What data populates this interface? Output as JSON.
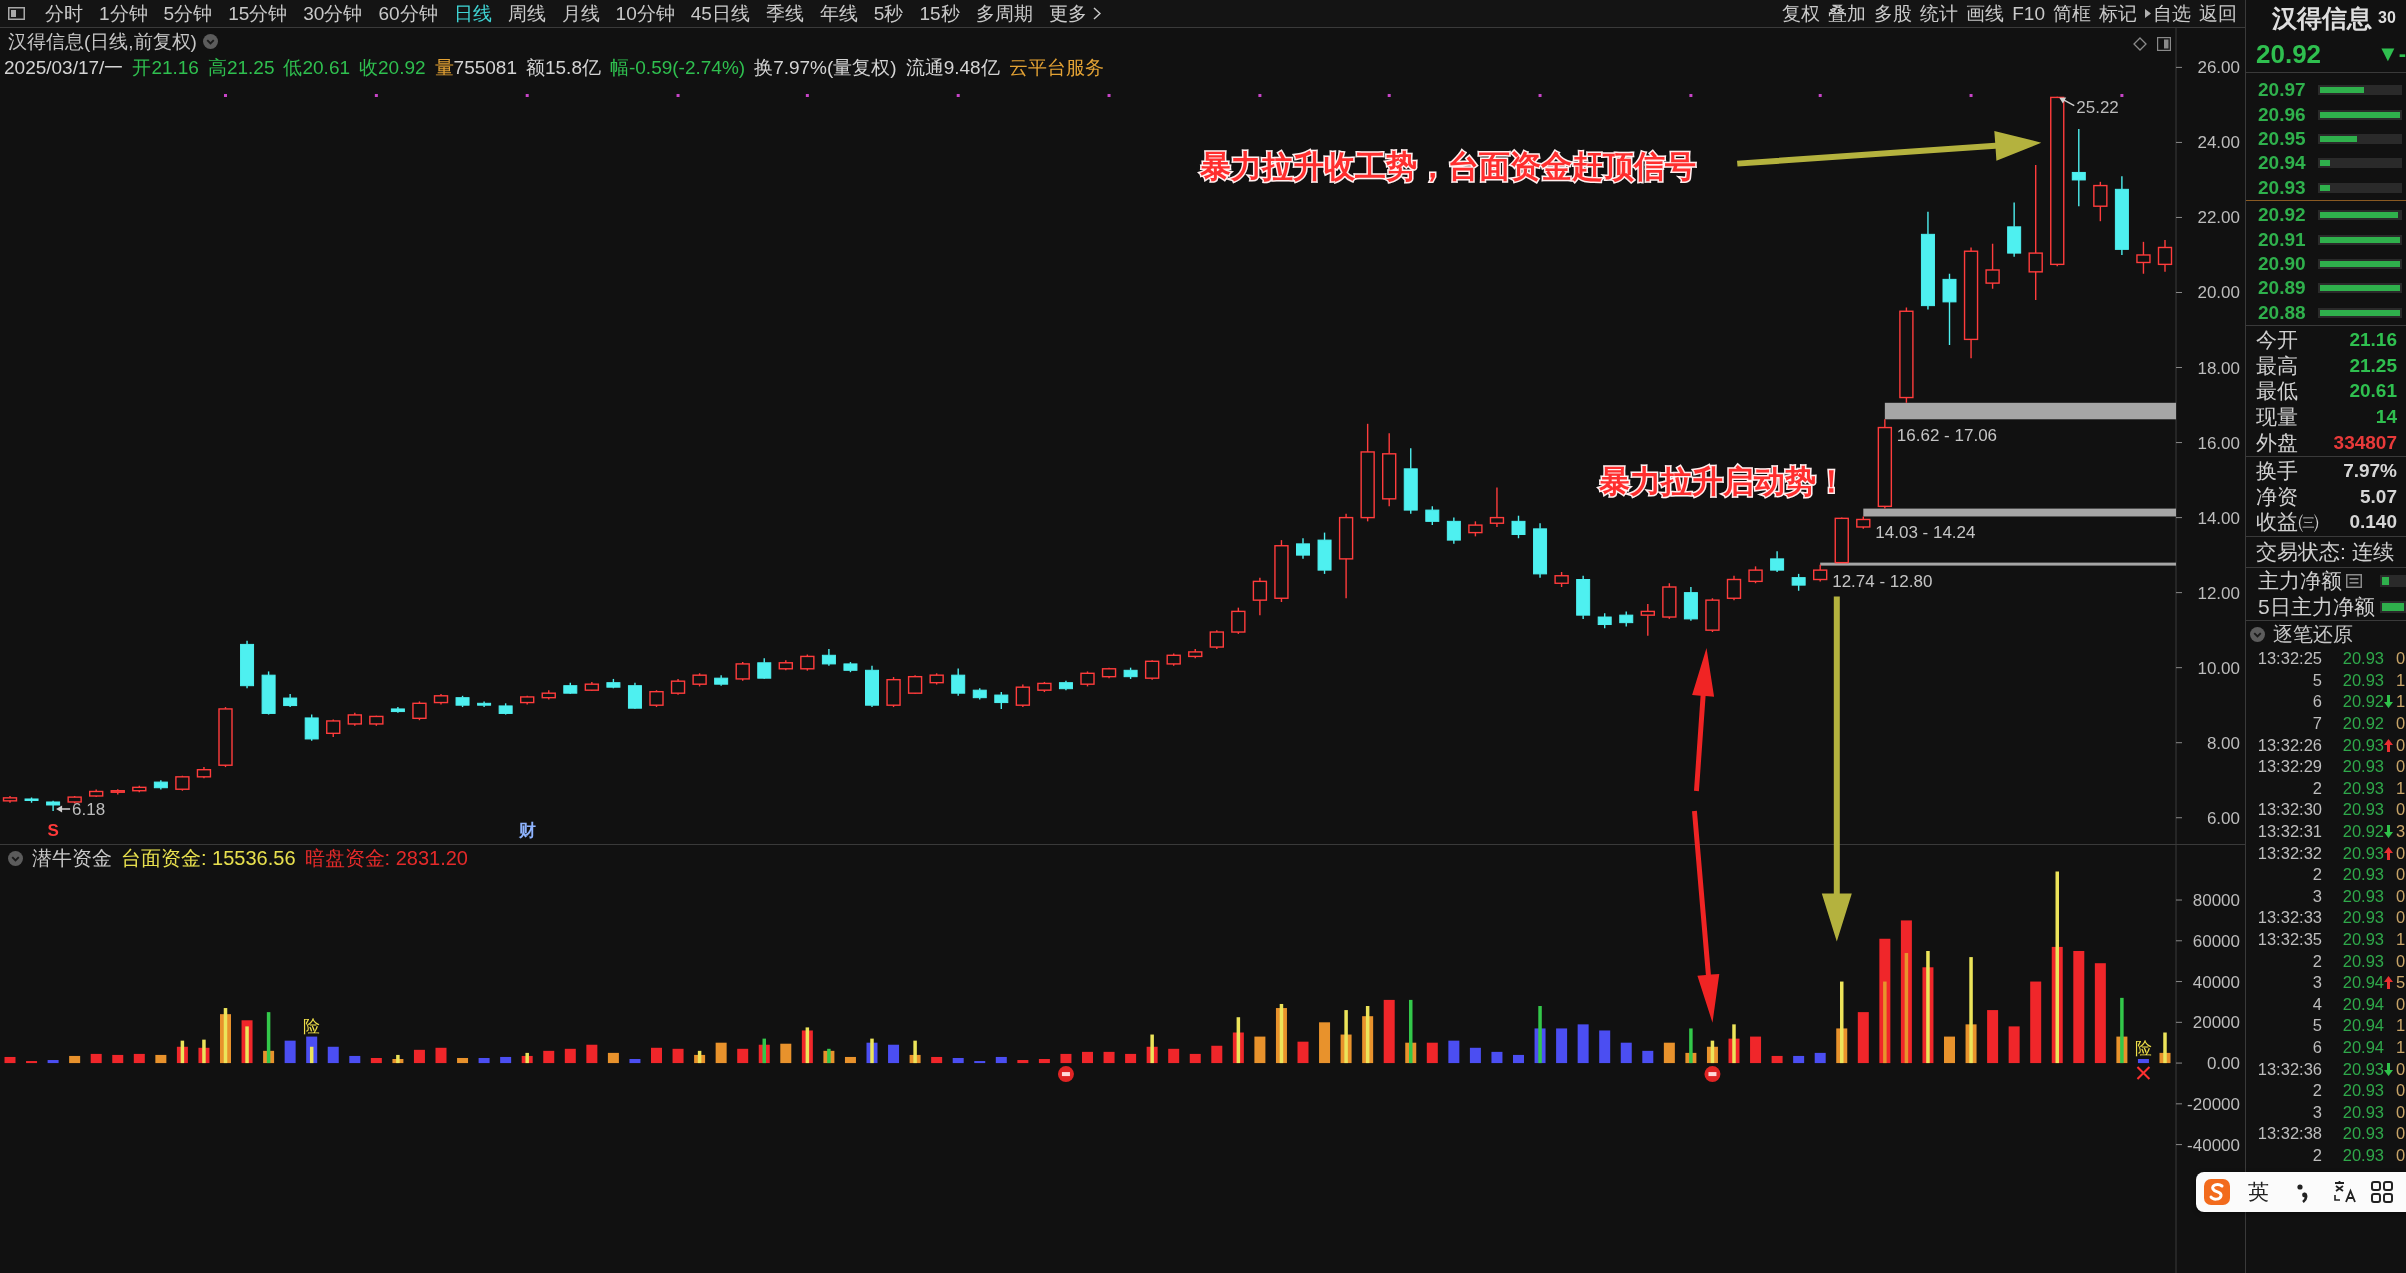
{
  "toolbar": {
    "tabs": [
      {
        "label": "分时",
        "kind": "period",
        "selected": false
      },
      {
        "label": "1分钟",
        "kind": "period",
        "selected": false
      },
      {
        "label": "5分钟",
        "kind": "period",
        "selected": false
      },
      {
        "label": "15分钟",
        "kind": "period",
        "selected": false
      },
      {
        "label": "30分钟",
        "kind": "period",
        "selected": false
      },
      {
        "label": "60分钟",
        "kind": "period",
        "selected": false
      },
      {
        "label": "日线",
        "kind": "period",
        "selected": true
      },
      {
        "label": "周线",
        "kind": "period",
        "selected": false
      },
      {
        "label": "月线",
        "kind": "period",
        "selected": false
      },
      {
        "label": "10分钟",
        "kind": "period",
        "selected": false
      },
      {
        "label": "45日线",
        "kind": "period",
        "selected": false
      },
      {
        "label": "季线",
        "kind": "period",
        "selected": false
      },
      {
        "label": "年线",
        "kind": "period",
        "selected": false
      },
      {
        "label": "5秒",
        "kind": "period",
        "selected": false
      },
      {
        "label": "15秒",
        "kind": "period",
        "selected": false
      },
      {
        "label": "多周期",
        "kind": "period",
        "selected": false
      },
      {
        "label": "更多",
        "kind": "menu",
        "selected": false
      }
    ],
    "tools": [
      {
        "label": "复权",
        "submenu": false
      },
      {
        "label": "叠加",
        "submenu": false
      },
      {
        "label": "多股",
        "submenu": false
      },
      {
        "label": "统计",
        "submenu": false
      },
      {
        "label": "画线",
        "submenu": false
      },
      {
        "label": "F10",
        "submenu": false
      },
      {
        "label": "简框",
        "submenu": false
      },
      {
        "label": "标记",
        "submenu": false
      },
      {
        "label": "自选",
        "submenu": true
      },
      {
        "label": "返回",
        "submenu": false
      }
    ]
  },
  "chart": {
    "title": "汉得信息(日线,前复权)",
    "quote_line": [
      {
        "parts": [
          {
            "text": "2025/03/17/一",
            "color": "#d4d4d4"
          }
        ]
      },
      {
        "parts": [
          {
            "text": "开21.16",
            "color": "#2fbf4f"
          }
        ]
      },
      {
        "parts": [
          {
            "text": "高21.25",
            "color": "#2fbf4f"
          }
        ]
      },
      {
        "parts": [
          {
            "text": "低20.61",
            "color": "#2fbf4f"
          }
        ]
      },
      {
        "parts": [
          {
            "text": "收20.92",
            "color": "#2fbf4f"
          }
        ]
      },
      {
        "parts": [
          {
            "text": "量",
            "color": "#e3a234"
          },
          {
            "text": "755081",
            "color": "#d4d4d4"
          }
        ]
      },
      {
        "parts": [
          {
            "text": "额15.8亿",
            "color": "#d4d4d4"
          }
        ]
      },
      {
        "parts": [
          {
            "text": "幅-0.59(-2.74%)",
            "color": "#2fbf4f"
          }
        ]
      },
      {
        "parts": [
          {
            "text": "换7.97%(量复权)",
            "color": "#d4d4d4"
          }
        ]
      },
      {
        "parts": [
          {
            "text": "流通9.48亿",
            "color": "#d4d4d4"
          }
        ]
      },
      {
        "parts": [
          {
            "text": "云平台服务",
            "color": "#e3a234"
          }
        ]
      }
    ],
    "indicator": {
      "name": "潜牛资金",
      "legend": [
        {
          "text": "台面资金: 15536.56",
          "color": "#e8e04e"
        },
        {
          "text": "暗盘资金: 2831.20",
          "color": "#e42a2a"
        }
      ]
    },
    "chart_data": [
      {
        "type": "candlestick",
        "ylim": [
          5.3,
          27.05
        ],
        "yticks": [
          {
            "value": 6,
            "label": "6.00"
          },
          {
            "value": 8,
            "label": "8.00"
          },
          {
            "value": 10,
            "label": "10.00"
          },
          {
            "value": 12,
            "label": "12.00"
          },
          {
            "value": 14,
            "label": "14.00"
          },
          {
            "value": 16,
            "label": "16.00"
          },
          {
            "value": 18,
            "label": "18.00"
          },
          {
            "value": 20,
            "label": "20.00"
          },
          {
            "value": 22,
            "label": "22.00"
          },
          {
            "value": 24,
            "label": "24.00"
          },
          {
            "value": 26,
            "label": "26.00"
          }
        ],
        "ohlc": [
          [
            6.45,
            6.58,
            6.4,
            6.53
          ],
          [
            6.5,
            6.54,
            6.4,
            6.46
          ],
          [
            6.42,
            6.45,
            6.18,
            6.34
          ],
          [
            6.42,
            6.58,
            6.38,
            6.55
          ],
          [
            6.58,
            6.75,
            6.55,
            6.7
          ],
          [
            6.7,
            6.76,
            6.62,
            6.72
          ],
          [
            6.72,
            6.85,
            6.68,
            6.81
          ],
          [
            6.95,
            7.0,
            6.75,
            6.8
          ],
          [
            6.76,
            7.12,
            6.72,
            7.09
          ],
          [
            7.09,
            7.35,
            7.05,
            7.28
          ],
          [
            7.4,
            8.95,
            7.35,
            8.9
          ],
          [
            10.62,
            10.72,
            9.45,
            9.52
          ],
          [
            9.8,
            9.9,
            8.75,
            8.78
          ],
          [
            9.19,
            9.3,
            8.95,
            8.99
          ],
          [
            8.66,
            8.75,
            8.05,
            8.1
          ],
          [
            8.25,
            8.62,
            8.15,
            8.58
          ],
          [
            8.5,
            8.8,
            8.45,
            8.74
          ],
          [
            8.5,
            8.72,
            8.45,
            8.7
          ],
          [
            8.9,
            8.95,
            8.8,
            8.83
          ],
          [
            8.65,
            9.1,
            8.6,
            9.05
          ],
          [
            9.07,
            9.3,
            9.02,
            9.25
          ],
          [
            9.2,
            9.25,
            8.95,
            9.0
          ],
          [
            9.05,
            9.1,
            8.95,
            9.0
          ],
          [
            8.98,
            9.05,
            8.75,
            8.78
          ],
          [
            9.07,
            9.25,
            9.02,
            9.22
          ],
          [
            9.2,
            9.4,
            9.15,
            9.32
          ],
          [
            9.52,
            9.6,
            9.3,
            9.32
          ],
          [
            9.4,
            9.62,
            9.38,
            9.56
          ],
          [
            9.6,
            9.7,
            9.45,
            9.48
          ],
          [
            9.52,
            9.6,
            8.9,
            8.92
          ],
          [
            9.0,
            9.4,
            8.95,
            9.36
          ],
          [
            9.32,
            9.7,
            9.28,
            9.64
          ],
          [
            9.56,
            9.85,
            9.5,
            9.8
          ],
          [
            9.72,
            9.8,
            9.52,
            9.56
          ],
          [
            9.7,
            10.15,
            9.65,
            10.1
          ],
          [
            10.13,
            10.25,
            9.7,
            9.72
          ],
          [
            9.97,
            10.2,
            9.93,
            10.13
          ],
          [
            9.97,
            10.35,
            9.92,
            10.3
          ],
          [
            10.33,
            10.5,
            10.05,
            10.1
          ],
          [
            10.1,
            10.15,
            9.88,
            9.93
          ],
          [
            9.93,
            10.05,
            8.95,
            9.0
          ],
          [
            9.0,
            9.75,
            8.95,
            9.68
          ],
          [
            9.32,
            9.8,
            9.3,
            9.76
          ],
          [
            9.6,
            9.85,
            9.55,
            9.8
          ],
          [
            9.8,
            9.98,
            9.25,
            9.32
          ],
          [
            9.4,
            9.45,
            9.15,
            9.2
          ],
          [
            9.27,
            9.35,
            8.9,
            9.07
          ],
          [
            9.0,
            9.55,
            8.95,
            9.48
          ],
          [
            9.4,
            9.62,
            9.35,
            9.58
          ],
          [
            9.6,
            9.65,
            9.4,
            9.44
          ],
          [
            9.56,
            9.9,
            9.5,
            9.85
          ],
          [
            9.76,
            10.0,
            9.72,
            9.97
          ],
          [
            9.93,
            10.0,
            9.7,
            9.76
          ],
          [
            9.72,
            10.2,
            9.68,
            10.17
          ],
          [
            10.1,
            10.38,
            10.05,
            10.33
          ],
          [
            10.3,
            10.5,
            10.25,
            10.42
          ],
          [
            10.55,
            11.0,
            10.5,
            10.95
          ],
          [
            10.95,
            11.6,
            10.9,
            11.5
          ],
          [
            11.8,
            12.4,
            11.4,
            12.3
          ],
          [
            11.85,
            13.4,
            11.75,
            13.25
          ],
          [
            13.3,
            13.45,
            12.9,
            13.0
          ],
          [
            13.4,
            13.6,
            12.5,
            12.6
          ],
          [
            12.9,
            14.1,
            11.85,
            14.0
          ],
          [
            14.0,
            16.5,
            13.9,
            15.75
          ],
          [
            14.5,
            16.25,
            14.3,
            15.7
          ],
          [
            15.3,
            15.85,
            14.1,
            14.2
          ],
          [
            14.2,
            14.3,
            13.8,
            13.9
          ],
          [
            13.9,
            14.0,
            13.3,
            13.4
          ],
          [
            13.6,
            13.9,
            13.5,
            13.8
          ],
          [
            13.85,
            14.8,
            13.75,
            14.0
          ],
          [
            13.9,
            14.05,
            13.45,
            13.55
          ],
          [
            13.7,
            13.85,
            12.4,
            12.5
          ],
          [
            12.25,
            12.55,
            12.15,
            12.45
          ],
          [
            12.35,
            12.45,
            11.3,
            11.4
          ],
          [
            11.35,
            11.45,
            11.05,
            11.15
          ],
          [
            11.4,
            11.5,
            11.1,
            11.2
          ],
          [
            11.4,
            11.7,
            10.85,
            11.5
          ],
          [
            11.35,
            12.25,
            11.3,
            12.15
          ],
          [
            12.0,
            12.15,
            11.25,
            11.3
          ],
          [
            11.0,
            11.85,
            10.95,
            11.8
          ],
          [
            11.85,
            12.45,
            11.8,
            12.35
          ],
          [
            12.3,
            12.7,
            12.25,
            12.6
          ],
          [
            12.9,
            13.1,
            12.55,
            12.6
          ],
          [
            12.4,
            12.5,
            12.05,
            12.2
          ],
          [
            12.35,
            12.74,
            12.3,
            12.6
          ],
          [
            12.8,
            14.0,
            12.8,
            13.98
          ],
          [
            13.75,
            14.03,
            13.7,
            13.95
          ],
          [
            14.3,
            16.62,
            14.24,
            16.4
          ],
          [
            17.2,
            19.6,
            17.06,
            19.5
          ],
          [
            21.55,
            22.15,
            19.55,
            19.65
          ],
          [
            20.35,
            20.5,
            18.6,
            19.75
          ],
          [
            18.75,
            21.2,
            18.25,
            21.1
          ],
          [
            20.25,
            21.3,
            20.1,
            20.6
          ],
          [
            21.75,
            22.4,
            20.95,
            21.05
          ],
          [
            20.55,
            23.4,
            19.8,
            21.05
          ],
          [
            20.75,
            25.22,
            20.7,
            25.2
          ],
          [
            23.2,
            24.36,
            22.3,
            23.0
          ],
          [
            22.3,
            22.95,
            21.9,
            22.85
          ],
          [
            22.75,
            23.1,
            21.0,
            21.15
          ],
          [
            20.8,
            21.35,
            20.5,
            21.0
          ],
          [
            20.75,
            21.4,
            20.55,
            21.2
          ]
        ],
        "bands": [
          {
            "axis": "y",
            "from": 16.62,
            "to": 17.06,
            "label": "16.62 - 17.06",
            "color": "#a6a6a6"
          },
          {
            "axis": "y",
            "from": 14.03,
            "to": 14.24,
            "label": "14.03 - 14.24",
            "color": "#a6a6a6"
          },
          {
            "axis": "y",
            "from": 12.74,
            "to": 12.8,
            "label": "12.74 - 12.80",
            "color": "#a6a6a6"
          }
        ],
        "annotations": [
          "25.22",
          "6.18",
          "S",
          "财",
          "暴力拉升收工势，台面资金赶顶信号",
          "暴力拉升启动势！"
        ]
      },
      {
        "type": "bar",
        "ylim": [
          -103000,
          107000
        ],
        "yticks": [
          {
            "value": 80000,
            "label": "80000"
          },
          {
            "value": 60000,
            "label": "60000"
          },
          {
            "value": 40000,
            "label": "40000"
          },
          {
            "value": 20000,
            "label": "20000"
          },
          {
            "value": 0,
            "label": "0.00"
          },
          {
            "value": -20000,
            "label": "-20000"
          },
          {
            "value": -40000,
            "label": "-40000"
          }
        ],
        "series": [
          {
            "values": [
              3000,
              1000,
              1500,
              3500,
              4500,
              4000,
              4500,
              4000,
              8000,
              7500,
              24000,
              21000,
              6000,
              11000,
              13000,
              8000,
              3500,
              2500,
              2000,
              6500,
              7500,
              2500,
              2500,
              3000,
              3500,
              6000,
              7000,
              9000,
              5000,
              2000,
              7500,
              7000,
              4000,
              10000,
              7000,
              9000,
              9500,
              16000,
              6000,
              3000,
              10000,
              9000,
              4000,
              3000,
              2500,
              1000,
              3000,
              1500,
              2000,
              4500,
              5500,
              5500,
              4500,
              8000,
              7000,
              4500,
              8500,
              15000,
              13000,
              27000,
              10500,
              20000,
              14000,
              23000,
              31000,
              10000,
              10000,
              11000,
              7500,
              5500,
              4000,
              17000,
              17000,
              19000,
              16000,
              10000,
              6000,
              10000,
              5000,
              8000,
              12000,
              13000,
              3500,
              3500,
              5000,
              17000,
              25000,
              61000,
              70000,
              47000,
              13000,
              19000,
              26000,
              18000,
              40000,
              57000,
              55000,
              49000,
              13000,
              2000,
              5000
            ],
            "colors": [
              "#f0262a",
              "#f0262a",
              "#4b4ef2",
              "#e8922c",
              "#f0262a",
              "#f0262a",
              "#f0262a",
              "#e8922c",
              "#f0262a",
              "#f0262a",
              "#e8922c",
              "#f0262a",
              "#e8922c",
              "#4b4ef2",
              "#4b4ef2",
              "#4b4ef2",
              "#4b4ef2",
              "#f0262a",
              "#e8922c",
              "#f0262a",
              "#f0262a",
              "#e8922c",
              "#4b4ef2",
              "#4b4ef2",
              "#f0262a",
              "#f0262a",
              "#f0262a",
              "#f0262a",
              "#e8922c",
              "#4b4ef2",
              "#f0262a",
              "#f0262a",
              "#e8922c",
              "#e8922c",
              "#f0262a",
              "#f0262a",
              "#e8922c",
              "#f0262a",
              "#e8922c",
              "#e8922c",
              "#4b4ef2",
              "#4b4ef2",
              "#e8922c",
              "#f0262a",
              "#4b4ef2",
              "#4b4ef2",
              "#4b4ef2",
              "#f0262a",
              "#f0262a",
              "#f0262a",
              "#f0262a",
              "#f0262a",
              "#f0262a",
              "#f0262a",
              "#f0262a",
              "#f0262a",
              "#f0262a",
              "#f0262a",
              "#e8922c",
              "#e8922c",
              "#f0262a",
              "#e8922c",
              "#e8922c",
              "#e8922c",
              "#f0262a",
              "#e8922c",
              "#f0262a",
              "#4b4ef2",
              "#4b4ef2",
              "#4b4ef2",
              "#4b4ef2",
              "#4b4ef2",
              "#4b4ef2",
              "#4b4ef2",
              "#4b4ef2",
              "#4b4ef2",
              "#4b4ef2",
              "#e8922c",
              "#e8922c",
              "#e8922c",
              "#f0262a",
              "#f0262a",
              "#f0262a",
              "#4b4ef2",
              "#4b4ef2",
              "#e8922c",
              "#f0262a",
              "#f0262a",
              "#f0262a",
              "#f0262a",
              "#e8922c",
              "#e8922c",
              "#f0262a",
              "#f0262a",
              "#f0262a",
              "#f0262a",
              "#f0262a",
              "#f0262a",
              "#e8922c",
              "#4b4ef2",
              "#e8922c"
            ]
          },
          {
            "values": [
              null,
              null,
              null,
              null,
              null,
              null,
              null,
              null,
              11000,
              11500,
              27000,
              18000,
              25000,
              null,
              8000,
              null,
              null,
              null,
              4000,
              null,
              null,
              null,
              null,
              null,
              5000,
              null,
              null,
              null,
              null,
              null,
              null,
              null,
              6000,
              null,
              null,
              12000,
              null,
              17500,
              7000,
              null,
              12000,
              null,
              11000,
              null,
              null,
              null,
              null,
              null,
              null,
              null,
              null,
              null,
              null,
              14000,
              null,
              null,
              null,
              22500,
              null,
              29000,
              null,
              null,
              26000,
              28000,
              null,
              31000,
              null,
              null,
              null,
              null,
              null,
              28000,
              null,
              null,
              null,
              null,
              null,
              null,
              17000,
              11000,
              19000,
              null,
              null,
              null,
              null,
              40000,
              null,
              40000,
              54000,
              55000,
              null,
              52000,
              null,
              null,
              null,
              94000,
              null,
              null,
              32000,
              null,
              15000
            ],
            "colors": [
              null,
              null,
              null,
              null,
              null,
              null,
              null,
              null,
              "#ece45a",
              "#ece45a",
              "#ece45a",
              "#ece45a",
              "#33c84a",
              null,
              "#ece45a",
              null,
              null,
              null,
              "#ece45a",
              null,
              null,
              null,
              null,
              null,
              "#ece45a",
              null,
              null,
              null,
              null,
              null,
              null,
              null,
              "#ece45a",
              null,
              null,
              "#33c84a",
              null,
              "#ece45a",
              "#33c84a",
              null,
              "#ece45a",
              null,
              "#ece45a",
              null,
              null,
              null,
              null,
              null,
              null,
              null,
              null,
              null,
              null,
              "#ece45a",
              null,
              null,
              null,
              "#ece45a",
              null,
              "#ece45a",
              null,
              null,
              "#ece45a",
              "#ece45a",
              null,
              "#33c84a",
              null,
              null,
              null,
              null,
              null,
              "#33c84a",
              null,
              null,
              null,
              null,
              null,
              null,
              "#33c84a",
              "#ece45a",
              "#ece45a",
              null,
              null,
              null,
              null,
              "#ece45a",
              null,
              "#e8922c",
              "#e8922c",
              "#ece45a",
              null,
              "#ece45a",
              null,
              null,
              null,
              "#ece45a",
              null,
              null,
              "#33c84a",
              null,
              "#ece45a"
            ]
          }
        ],
        "annotations": [
          "险",
          "险"
        ]
      }
    ]
  },
  "quote_panel": {
    "name": "汉得信息",
    "code": "30",
    "price": "20.92",
    "change": "▼-",
    "falling": true,
    "asks": [
      {
        "price": "20.97",
        "level": 0.55
      },
      {
        "price": "20.96",
        "level": 1
      },
      {
        "price": "20.95",
        "level": 0.46
      },
      {
        "price": "20.94",
        "level": 0.13
      },
      {
        "price": "20.93",
        "level": 0.13
      }
    ],
    "bids": [
      {
        "price": "20.92",
        "level": 0.97
      },
      {
        "price": "20.91",
        "level": 1
      },
      {
        "price": "20.90",
        "level": 1
      },
      {
        "price": "20.89",
        "level": 1
      },
      {
        "price": "20.88",
        "level": 1
      }
    ],
    "stats": [
      {
        "label": "今开",
        "value": "21.16",
        "color": "#2fbf4f"
      },
      {
        "label": "最高",
        "value": "21.25",
        "color": "#2fbf4f"
      },
      {
        "label": "最低",
        "value": "20.61",
        "color": "#2fbf4f"
      },
      {
        "label": "现量",
        "value": "14",
        "color": "#2fbf4f"
      },
      {
        "label": "外盘",
        "value": "334807",
        "color": "#e83a3a"
      }
    ],
    "fundamentals": [
      {
        "label": "换手",
        "value": "7.97%"
      },
      {
        "label": "净资",
        "value": "5.07"
      },
      {
        "label": "收益㈢",
        "value": "0.140"
      }
    ],
    "status": "交易状态: 连续",
    "flows": [
      {
        "label": "主力净额",
        "detail_icon": true,
        "level": 0.3
      },
      {
        "label": "5日主力净额",
        "detail_icon": false,
        "level": 1
      }
    ]
  },
  "trades": {
    "title": "逐笔还原",
    "rows": [
      {
        "time": "13:32:25",
        "price": "20.93",
        "kind": "flat",
        "volume": "0"
      },
      {
        "time": "5",
        "price": "20.93",
        "kind": "flat",
        "volume": "1"
      },
      {
        "time": "6",
        "price": "20.92",
        "kind": "down",
        "volume": "1"
      },
      {
        "time": "7",
        "price": "20.92",
        "kind": "flat",
        "volume": "0"
      },
      {
        "time": "13:32:26",
        "price": "20.93",
        "kind": "up",
        "volume": "0"
      },
      {
        "time": "13:32:29",
        "price": "20.93",
        "kind": "flat",
        "volume": "0"
      },
      {
        "time": "2",
        "price": "20.93",
        "kind": "flat",
        "volume": "1"
      },
      {
        "time": "13:32:30",
        "price": "20.93",
        "kind": "flat",
        "volume": "0"
      },
      {
        "time": "13:32:31",
        "price": "20.92",
        "kind": "down",
        "volume": "3"
      },
      {
        "time": "13:32:32",
        "price": "20.93",
        "kind": "up",
        "volume": "0"
      },
      {
        "time": "2",
        "price": "20.93",
        "kind": "flat",
        "volume": "0"
      },
      {
        "time": "3",
        "price": "20.93",
        "kind": "flat",
        "volume": "0"
      },
      {
        "time": "13:32:33",
        "price": "20.93",
        "kind": "flat",
        "volume": "0"
      },
      {
        "time": "13:32:35",
        "price": "20.93",
        "kind": "flat",
        "volume": "1"
      },
      {
        "time": "2",
        "price": "20.93",
        "kind": "flat",
        "volume": "0"
      },
      {
        "time": "3",
        "price": "20.94",
        "kind": "up",
        "volume": "5"
      },
      {
        "time": "4",
        "price": "20.94",
        "kind": "flat",
        "volume": "0"
      },
      {
        "time": "5",
        "price": "20.94",
        "kind": "flat",
        "volume": "1"
      },
      {
        "time": "6",
        "price": "20.94",
        "kind": "flat",
        "volume": "1"
      },
      {
        "time": "13:32:36",
        "price": "20.93",
        "kind": "down",
        "volume": "0"
      },
      {
        "time": "2",
        "price": "20.93",
        "kind": "flat",
        "volume": "0"
      },
      {
        "time": "3",
        "price": "20.93",
        "kind": "flat",
        "volume": "0"
      },
      {
        "time": "13:32:38",
        "price": "20.93",
        "kind": "flat",
        "volume": "0"
      },
      {
        "time": "2",
        "price": "20.93",
        "kind": "flat",
        "volume": "0"
      }
    ]
  },
  "ime_toolbar": {
    "label": "英"
  }
}
